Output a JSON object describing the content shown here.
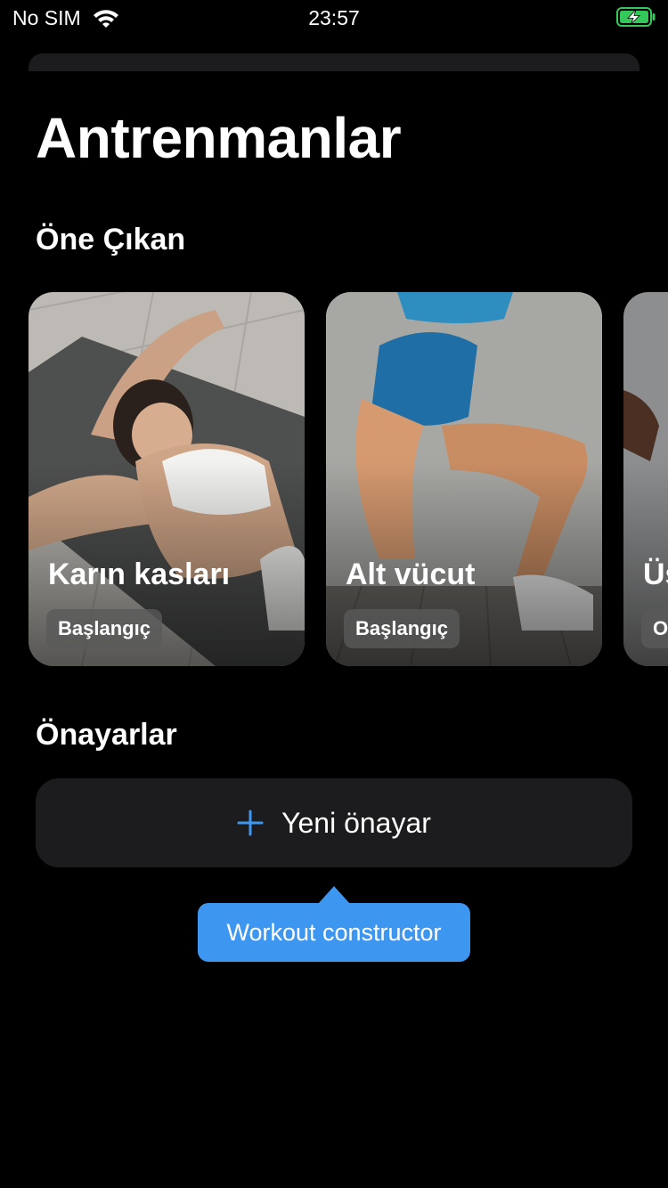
{
  "status_bar": {
    "carrier": "No SIM",
    "time": "23:57",
    "battery_color": "#34c759"
  },
  "page": {
    "title": "Antrenmanlar"
  },
  "featured": {
    "title": "Öne Çıkan",
    "cards": [
      {
        "title": "Karın kasları",
        "level": "Başlangıç"
      },
      {
        "title": "Alt vücut",
        "level": "Başlangıç"
      },
      {
        "title": "Üs",
        "level": "O"
      }
    ]
  },
  "presets": {
    "title": "Önayarlar",
    "new_button_label": "Yeni önayar",
    "plus_icon": "plus-icon",
    "accent_color": "#3d97f0"
  },
  "tooltip": {
    "text": "Workout constructor"
  }
}
